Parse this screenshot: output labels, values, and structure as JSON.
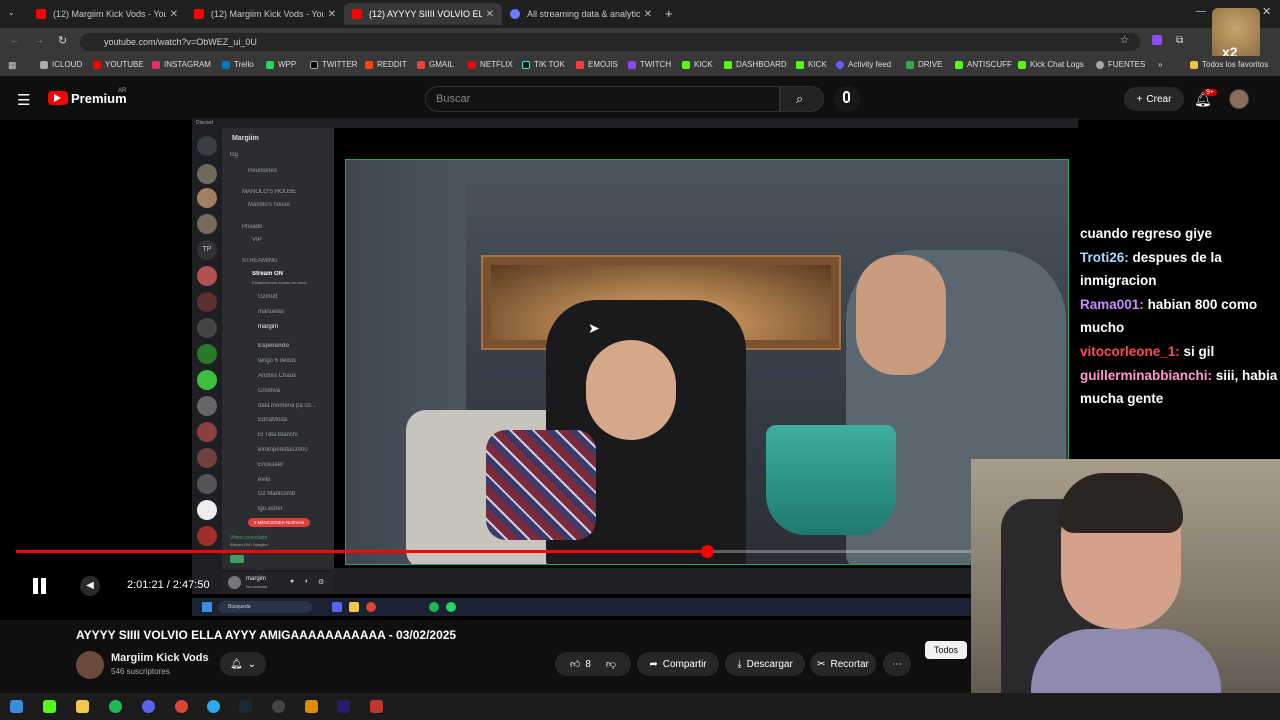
{
  "browser": {
    "tabs": [
      {
        "label": "(12) Margiim Kick Vods - YouTu",
        "active": false
      },
      {
        "label": "(12) Margiim Kick Vods - YouTu",
        "active": false
      },
      {
        "label": "(12) AYYYY SIIII VOLVIO ELL",
        "active": true
      },
      {
        "label": "All streaming data & analytics",
        "active": false
      }
    ],
    "url": "youtube.com/watch?v=ObWEZ_ui_0U",
    "bookmarks": [
      "ICLOUD",
      "YOUTUBE",
      "INSTAGRAM",
      "Trello",
      "WPP",
      "TWITTER",
      "REDDIT",
      "GMAIL",
      "NETFLIX",
      "TIK TOK",
      "EMOJIS",
      "TWITCH",
      "KICK",
      "DASHBOARD",
      "KICK",
      "Activity feed",
      "DRIVE",
      "ANTISCUFF",
      "Kick Chat Logs",
      "FUENTES"
    ],
    "bookmarks_more": "»",
    "all_favorites": "Todos los favoritos"
  },
  "youtube": {
    "logo": "Premium",
    "region": "AR",
    "search_placeholder": "Buscar",
    "create": "Crear",
    "notif_badge": "9+"
  },
  "discord": {
    "app_label": "Discord",
    "server_name": "Margiim",
    "channels": [
      "log",
      "Reuniones",
      "MANOLO'S HOUSE",
      "Manolo's house",
      "Privado",
      "VIP",
      "STREAMING",
      "Stream ON",
      "Estableciendo estado de canal",
      "Gzmutt",
      "manuelas",
      "margim",
      "Esperando",
      "tengo 6 dedos",
      "Andres Chaux",
      "Crooliva",
      "dala memeria pa co...",
      "EdnaModa",
      "El Tata Bianchi",
      "elrompetettas3000",
      "ErickJaer",
      "eviio",
      "Gz Manicomb",
      "lgo.asher"
    ],
    "mentions": "2 MENCIONES NUEVAS",
    "voice_status": "Video conectado",
    "voice_sub": "Stream ON / Margiim",
    "user": "margim",
    "user_status": "No molestar",
    "taskbar_search": "Búsqueda"
  },
  "chat": [
    {
      "user": "",
      "text": "cuando regreso giye",
      "color": "#ffffff"
    },
    {
      "user": "Troti26:",
      "text": "despues de la inmigracion",
      "color": "#a8d8ff"
    },
    {
      "user": "Rama001:",
      "text": "habian 800 como mucho",
      "color": "#c88cff"
    },
    {
      "user": "vitocorleone_1:",
      "text": "si gil",
      "color": "#ff4d4d"
    },
    {
      "user": "guillerminabbianchi:",
      "text": "siii, habia mucha gente",
      "color": "#ff9ad0"
    }
  ],
  "player": {
    "current": "2:01:21",
    "duration": "2:47:50",
    "time_text": "2:01:21 / 2:47:50",
    "progress_fraction": 0.724
  },
  "video": {
    "title": "AYYYY SIIII VOLVIO ELLA AYYY AMIGAAAAAAAAAAA - 03/02/2025",
    "channel": "Margiim Kick Vods",
    "subscribers": "546 suscriptores",
    "likes": "8",
    "share": "Compartir",
    "download": "Descargar",
    "clip": "Recortar",
    "filter": "Todos"
  },
  "overlay_badge": "x2",
  "colors": {
    "accent": "#ff0000",
    "discord_green": "#2f9f67"
  }
}
